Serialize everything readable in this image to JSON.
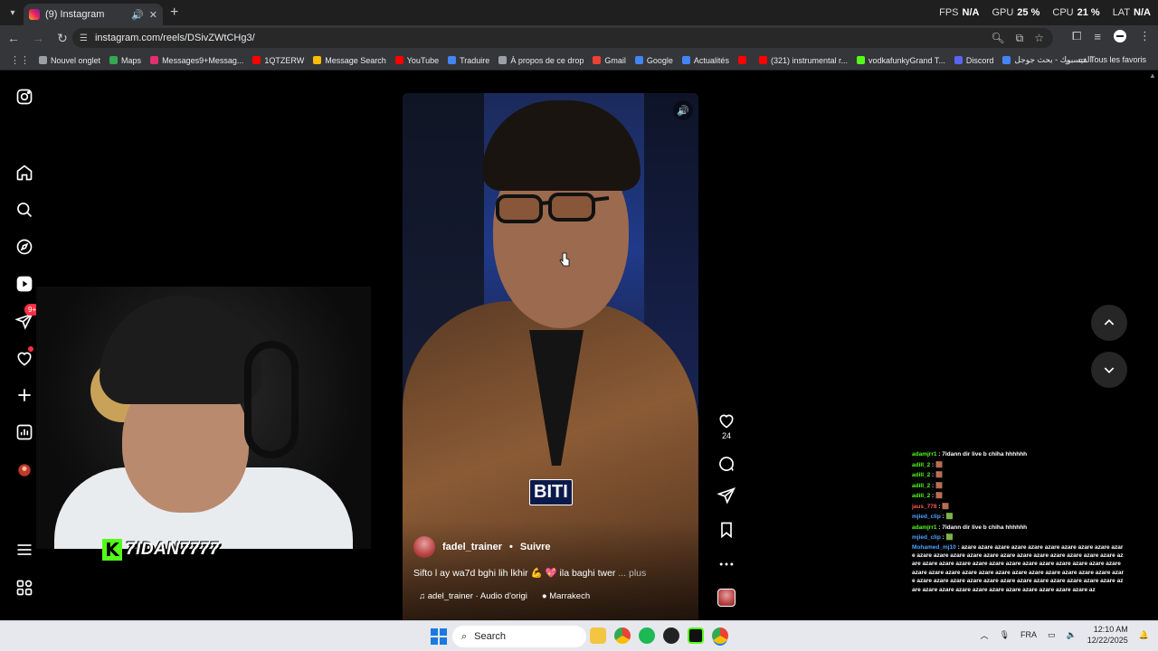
{
  "browser": {
    "tab_title": "(9) Instagram",
    "url": "instagram.com/reels/DSivZWtCHg3/",
    "perf": [
      {
        "key": "FPS",
        "value": "N/A"
      },
      {
        "key": "GPU",
        "value": "25 %"
      },
      {
        "key": "CPU",
        "value": "21 %"
      },
      {
        "key": "LAT",
        "value": "N/A"
      }
    ],
    "bookmarks": [
      {
        "label": "Nouvel onglet",
        "color": "#9aa0a6"
      },
      {
        "label": "Maps",
        "color": "#34a853"
      },
      {
        "label": "Messages9+Messag...",
        "color": "#e1306c"
      },
      {
        "label": "1QTZERW",
        "color": "#ff0000"
      },
      {
        "label": "Message Search",
        "color": "#fbbc05"
      },
      {
        "label": "YouTube",
        "color": "#ff0000"
      },
      {
        "label": "Traduire",
        "color": "#4285f4"
      },
      {
        "label": "À propos de ce drop",
        "color": "#9aa0a6"
      },
      {
        "label": "Gmail",
        "color": "#ea4335"
      },
      {
        "label": "Google",
        "color": "#4285f4"
      },
      {
        "label": "Actualités",
        "color": "#4285f4"
      },
      {
        "label": "",
        "color": "#ff0000"
      },
      {
        "label": "(321) instrumental r...",
        "color": "#ff0000"
      },
      {
        "label": "vodkafunkyGrand T...",
        "color": "#53fc18"
      },
      {
        "label": "Discord",
        "color": "#5865f2"
      },
      {
        "label": "الفيسبوك - بحث جوجل",
        "color": "#4285f4"
      }
    ],
    "all_bookmarks": "Tous les favoris"
  },
  "sidebar": {
    "messages_badge": "9+"
  },
  "stream": {
    "name": "7IDAN7777",
    "logo": "K"
  },
  "reel": {
    "caption_word": "BITI",
    "author": "fadel_trainer",
    "separator": "•",
    "follow": "Suivre",
    "description": "Sifto l ay wa7d bghi lih lkhir 💪 💖 ila baghi twer",
    "more": "... plus",
    "audio": "adel_trainer · Audio d'origi",
    "location": "Marrakech",
    "likes": "24"
  },
  "chat": [
    {
      "user": "adamjrr1",
      "cls": "",
      "msg": "7idann dir live b chiha hhhhhh"
    },
    {
      "user": "adill_2",
      "cls": "",
      "msg": "🟫"
    },
    {
      "user": "adill_2",
      "cls": "",
      "msg": "🟫"
    },
    {
      "user": "adill_2",
      "cls": "",
      "msg": "🟫"
    },
    {
      "user": "adill_2",
      "cls": "",
      "msg": "🟫"
    },
    {
      "user": "jaus_778",
      "cls": "r",
      "msg": "🟫"
    },
    {
      "user": "mjied_clip",
      "cls": "b",
      "msg": "🟩"
    },
    {
      "user": "adamjrr1",
      "cls": "",
      "msg": "7idann dir live b chiha hhhhhh"
    },
    {
      "user": "mjied_clip",
      "cls": "b",
      "msg": "🟩"
    }
  ],
  "chat_spam_user": "Mohamed_mj10",
  "chat_spam": "azare azare azare azare azare azare azare azare azare azare azare azare azare azare azare azare azare azare azare azare azare azare azare azare azare azare azare azare azare azare azare azare azare azare azare azare azare azare azare azare azare azare azare azare azare azare azare azare azare azare azare azare azare azare azare azare azare azare azare azare azare azare azare azare azare azare azare azare azare azare azare az",
  "taskbar": {
    "search": "Search",
    "lang": "FRA",
    "time": "12:10 AM",
    "date": "12/22/2025"
  }
}
